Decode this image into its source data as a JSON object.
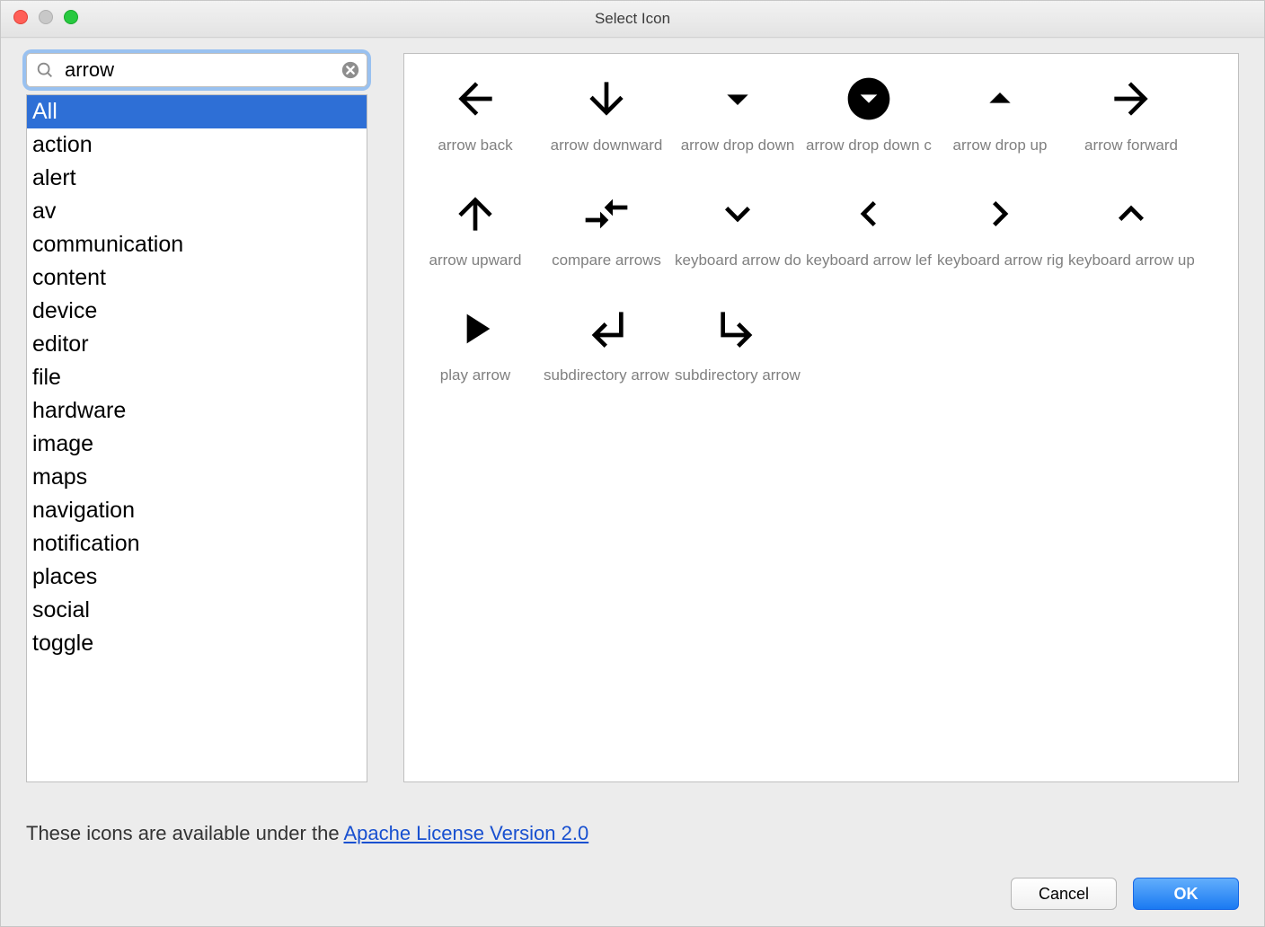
{
  "window": {
    "title": "Select Icon"
  },
  "search": {
    "value": "arrow"
  },
  "categories": {
    "selected_index": 0,
    "items": [
      "All",
      "action",
      "alert",
      "av",
      "communication",
      "content",
      "device",
      "editor",
      "file",
      "hardware",
      "image",
      "maps",
      "navigation",
      "notification",
      "places",
      "social",
      "toggle"
    ]
  },
  "icons": [
    {
      "name": "arrow back",
      "svg_key": "arrow_back"
    },
    {
      "name": "arrow downward",
      "svg_key": "arrow_downward"
    },
    {
      "name": "arrow drop down",
      "svg_key": "arrow_drop_down"
    },
    {
      "name": "arrow drop down circle",
      "svg_key": "arrow_drop_down_circle"
    },
    {
      "name": "arrow drop up",
      "svg_key": "arrow_drop_up"
    },
    {
      "name": "arrow forward",
      "svg_key": "arrow_forward"
    },
    {
      "name": "arrow upward",
      "svg_key": "arrow_upward"
    },
    {
      "name": "compare arrows",
      "svg_key": "compare_arrows"
    },
    {
      "name": "keyboard arrow down",
      "svg_key": "keyboard_arrow_down"
    },
    {
      "name": "keyboard arrow left",
      "svg_key": "keyboard_arrow_left"
    },
    {
      "name": "keyboard arrow right",
      "svg_key": "keyboard_arrow_right"
    },
    {
      "name": "keyboard arrow up",
      "svg_key": "keyboard_arrow_up"
    },
    {
      "name": "play arrow",
      "svg_key": "play_arrow"
    },
    {
      "name": "subdirectory arrow left",
      "svg_key": "subdirectory_arrow_left"
    },
    {
      "name": "subdirectory arrow right",
      "svg_key": "subdirectory_arrow_right"
    }
  ],
  "footer": {
    "license_prefix": "These icons are available under the ",
    "license_link_text": "Apache License Version 2.0",
    "cancel": "Cancel",
    "ok": "OK"
  }
}
